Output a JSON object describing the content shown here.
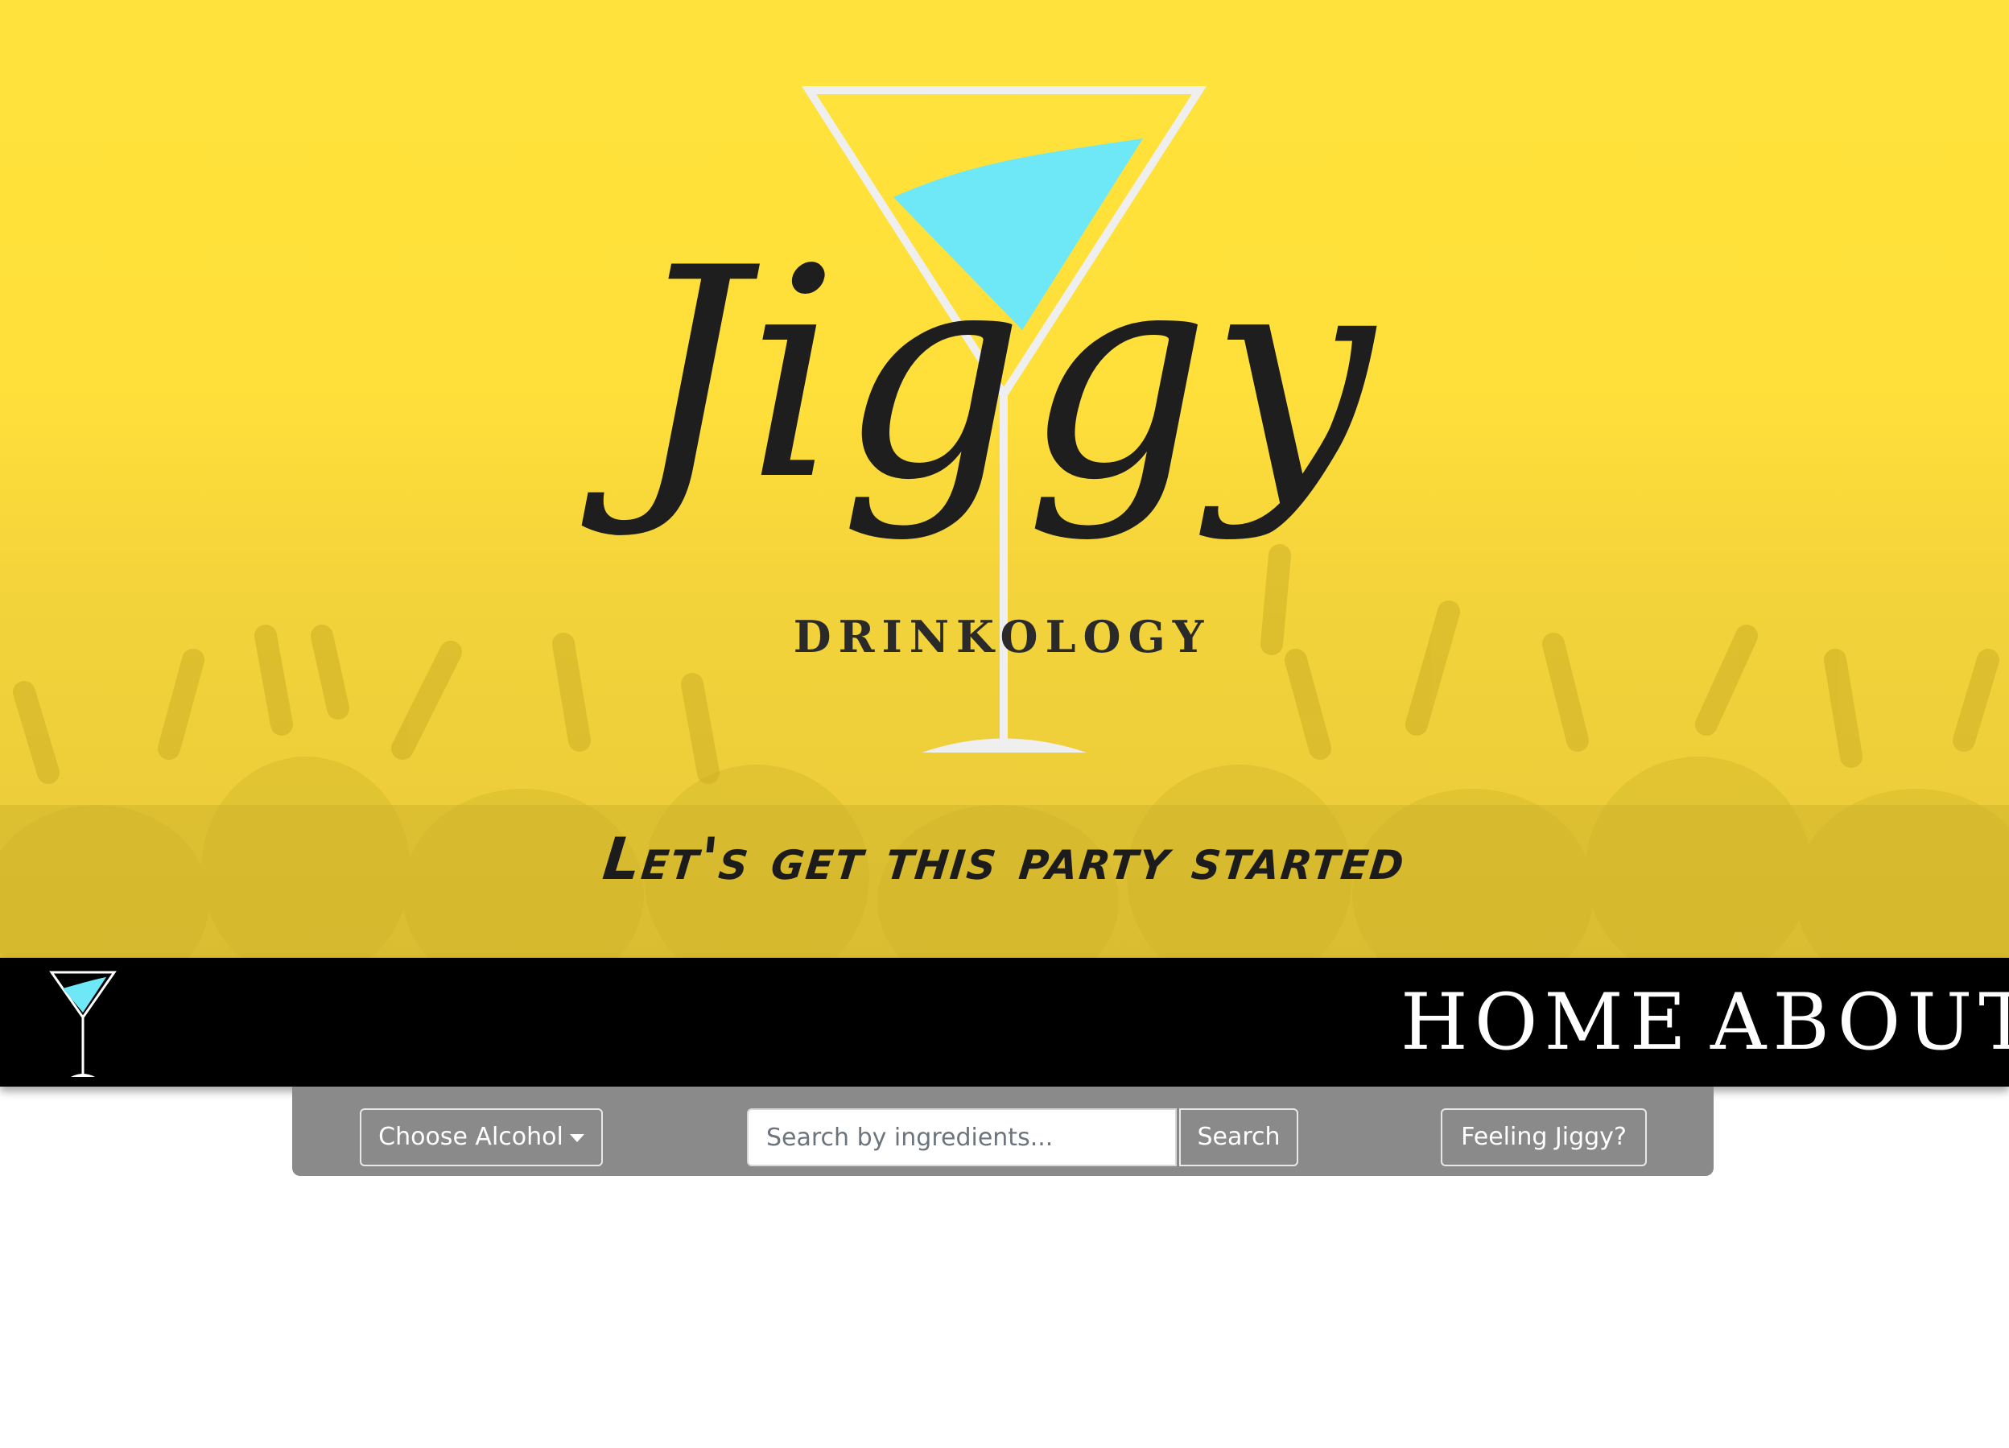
{
  "hero": {
    "logo": {
      "wordmark": "Jiggy",
      "subtitle": "DRINKOLOGY",
      "glass_liquid_color": "#6ee8f6",
      "glass_frame_color": "#eeeeee",
      "text_color": "#1e1e1e"
    },
    "tagline": "Let's get this party started",
    "background_color": "#ffe23b"
  },
  "navbar": {
    "logo_icon": "martini-glass-icon",
    "links": [
      "HOME",
      "ABOUT"
    ],
    "background_color": "#000000"
  },
  "toolbar": {
    "choose_alcohol_label": "Choose Alcohol",
    "search_placeholder": "Search by ingredients...",
    "search_value": "",
    "search_button_label": "Search",
    "feeling_jiggy_label": "Feeling Jiggy?",
    "background_color": "#8a8a8a"
  }
}
